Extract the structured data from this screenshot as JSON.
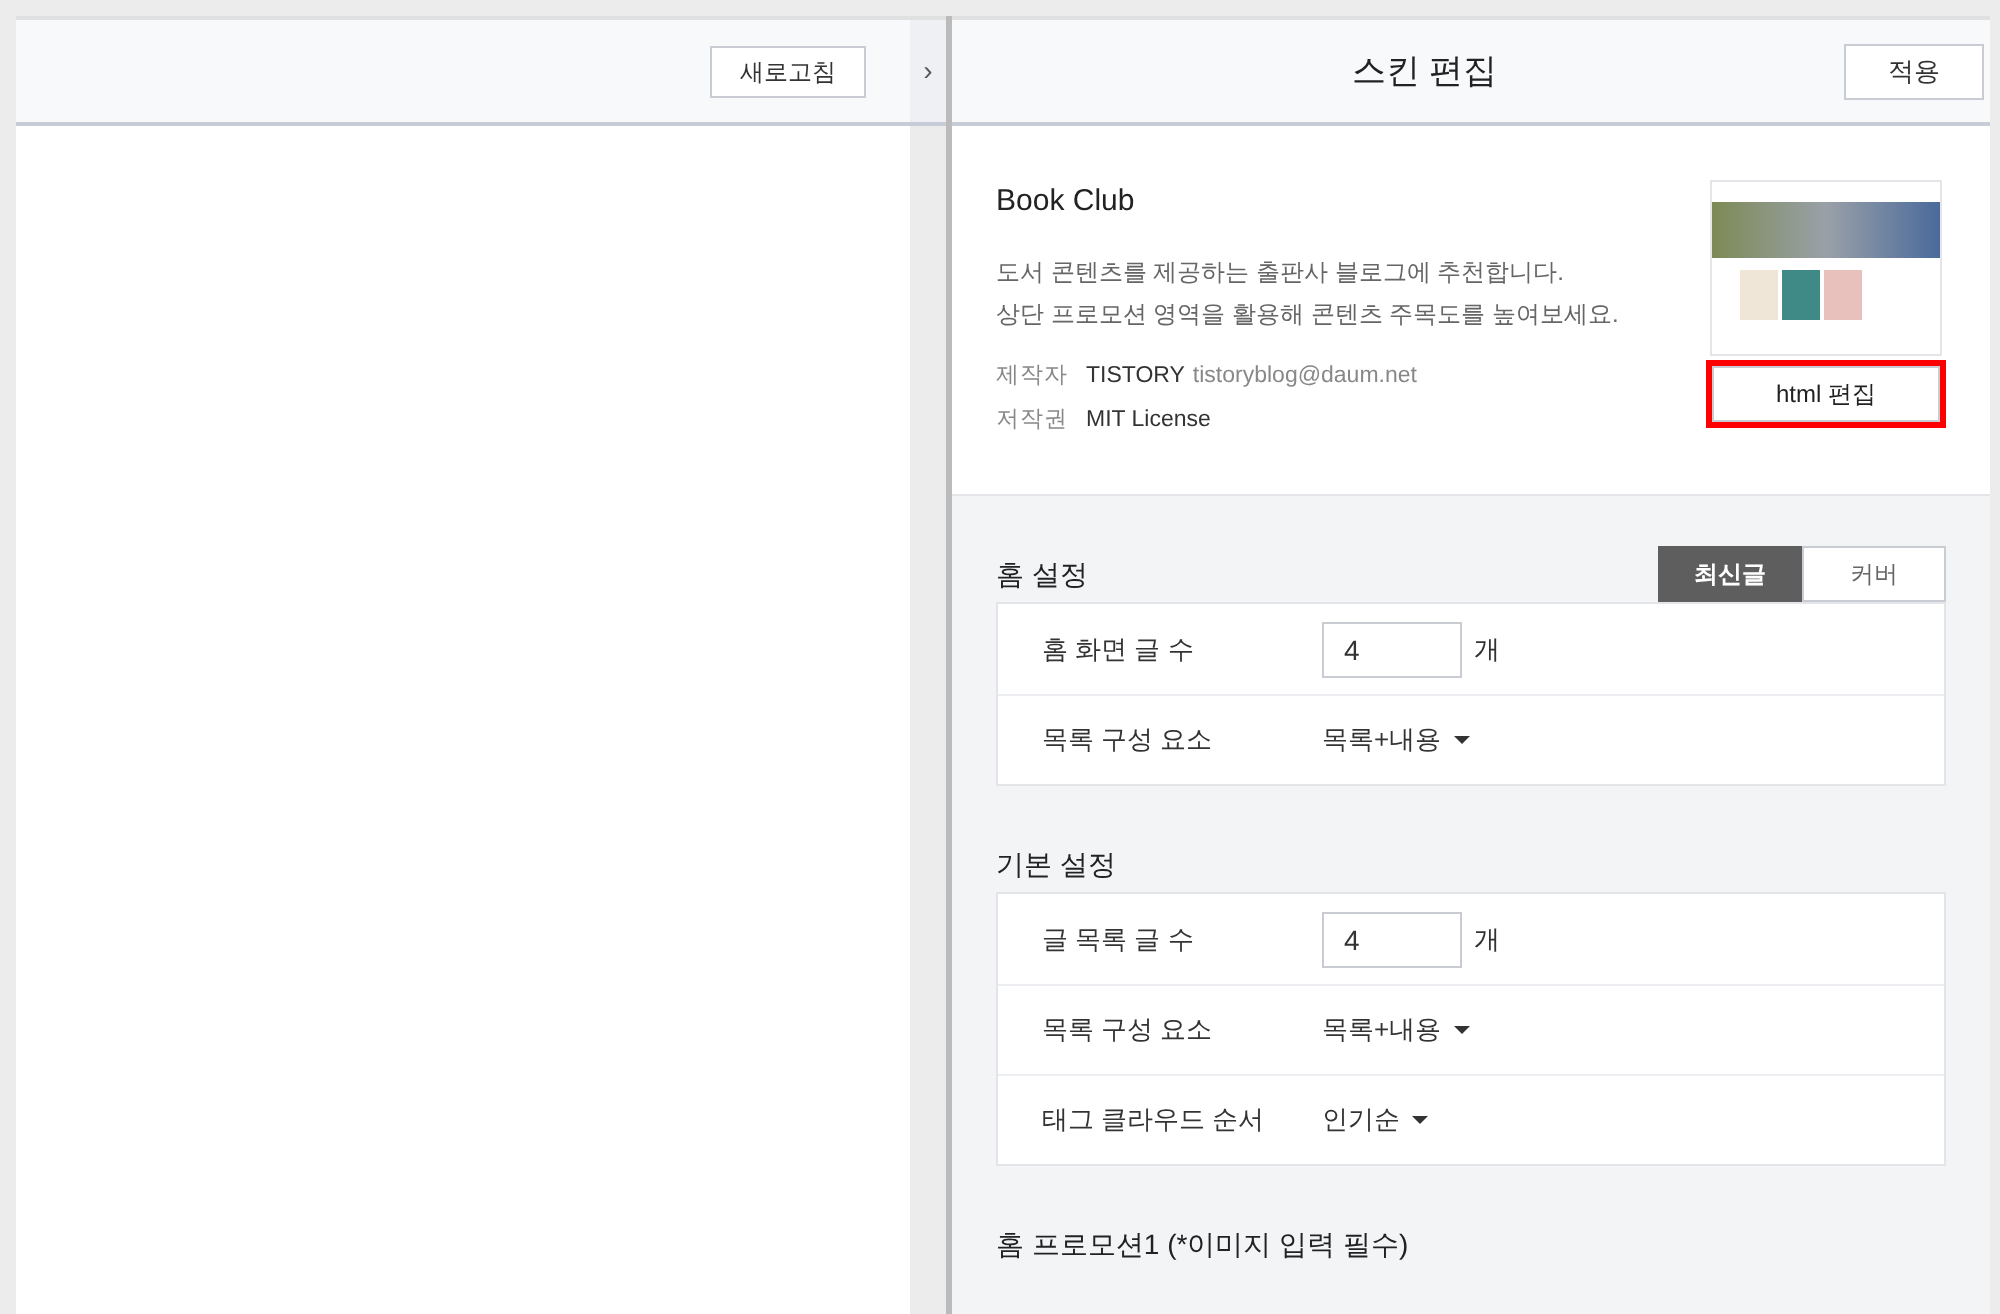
{
  "preview_toolbar": {
    "refresh_button": "새로고침",
    "collapse_toggle": "›"
  },
  "editor": {
    "title": "스킨 편집",
    "apply_button": "적용",
    "skin": {
      "name": "Book Club",
      "description": [
        "도서 콘텐츠를 제공하는 출판사 블로그에 추천합니다.",
        "상단 프로모션 영역을 활용해 콘텐츠 주목도를 높여보세요."
      ],
      "meta": [
        {
          "label": "제작자",
          "value": "TISTORY",
          "extra": "tistoryblog@daum.net"
        },
        {
          "label": "저작권",
          "value": "MIT License"
        }
      ],
      "html_edit_button": {
        "label": "html 편집",
        "highlighted": true
      }
    },
    "sections": [
      {
        "title": "홈 설정",
        "tabs": [
          {
            "label": "최신글",
            "selected": true
          },
          {
            "label": "커버",
            "selected": false
          }
        ],
        "rows": [
          {
            "kind": "number",
            "label": "홈 화면 글 수",
            "value": "4",
            "unit": "개"
          },
          {
            "kind": "select",
            "label": "목록 구성 요소",
            "value": "목록+내용"
          }
        ]
      },
      {
        "title": "기본 설정",
        "rows": [
          {
            "kind": "number",
            "label": "글 목록 글 수",
            "value": "4",
            "unit": "개"
          },
          {
            "kind": "select",
            "label": "목록 구성 요소",
            "value": "목록+내용"
          },
          {
            "kind": "select",
            "label": "태그 클라우드 순서",
            "value": "인기순"
          }
        ]
      },
      {
        "title": "홈 프로모션1 (*이미지 입력 필수)"
      }
    ]
  }
}
